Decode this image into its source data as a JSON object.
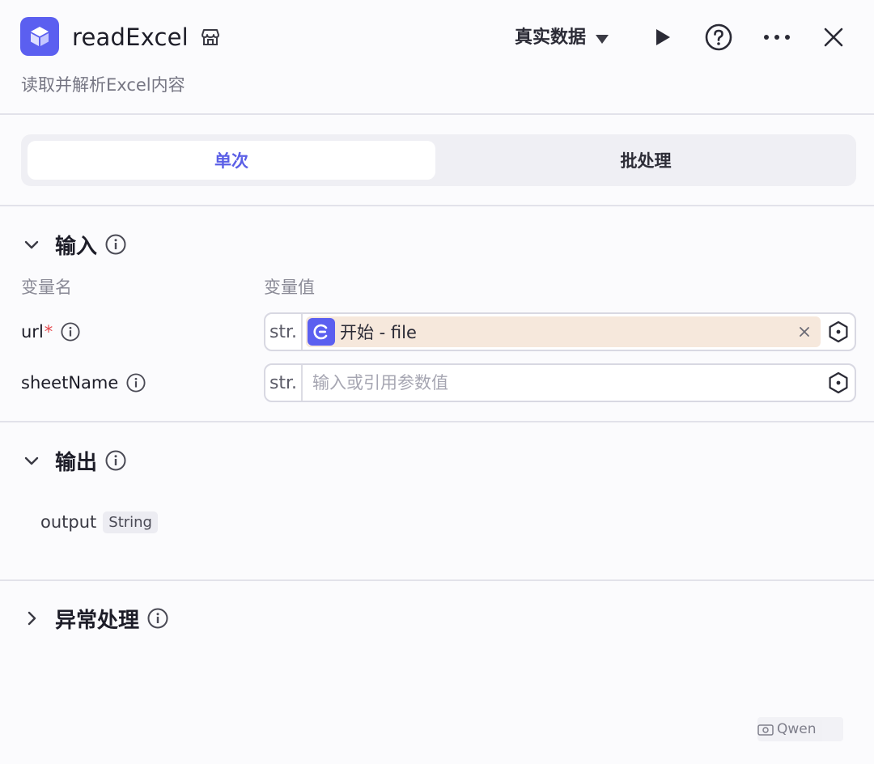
{
  "header": {
    "title": "readExcel",
    "subtitle": "读取并解析Excel内容",
    "data_mode": "真实数据",
    "icons": {
      "node": "cube-icon",
      "store": "store-icon",
      "run": "play-icon",
      "help": "help-icon",
      "more": "more-icon",
      "close": "close-icon"
    }
  },
  "tabs": [
    {
      "label": "单次",
      "active": true
    },
    {
      "label": "批处理",
      "active": false
    }
  ],
  "input_section": {
    "title": "输入",
    "col_name": "变量名",
    "col_value": "变量值",
    "params": [
      {
        "name": "url",
        "required": "*",
        "type": "str.",
        "reference": "开始 - file"
      },
      {
        "name": "sheetName",
        "type": "str.",
        "placeholder": "输入或引用参数值"
      }
    ]
  },
  "output_section": {
    "title": "输出",
    "outputs": [
      {
        "name": "output",
        "type": "String"
      }
    ]
  },
  "exception_section": {
    "title": "异常处理"
  },
  "watermark": "Qwen",
  "colors": {
    "accent": "#5b5ff0",
    "tab_active_text": "#5b5fe6",
    "reference_chip": "#f6e8dc",
    "required": "#e5484d"
  }
}
